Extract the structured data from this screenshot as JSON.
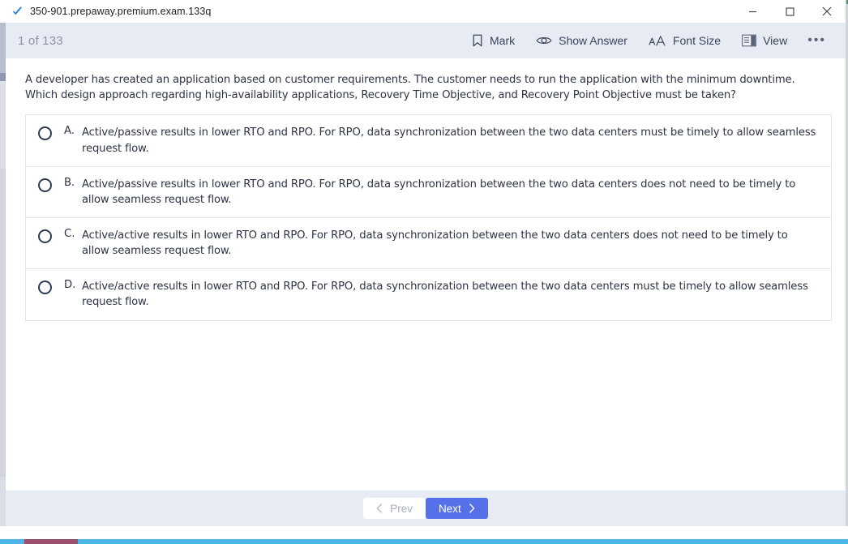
{
  "window": {
    "title": "350-901.prepaway.premium.exam.133q",
    "app_icon": "checkmark-icon",
    "controls": {
      "minimize": "minimize-icon",
      "maximize": "maximize-icon",
      "close": "close-icon"
    }
  },
  "toolbar": {
    "counter": "1 of 133",
    "actions": [
      {
        "label": "Mark",
        "icon": "bookmark-icon"
      },
      {
        "label": "Show Answer",
        "icon": "eye-icon"
      },
      {
        "label": "Font Size",
        "icon": "font-size-icon"
      },
      {
        "label": "View",
        "icon": "view-layout-icon"
      }
    ],
    "overflow": "•••"
  },
  "question": {
    "text": "A developer has created an application based on customer requirements. The customer needs to run the application with the minimum downtime. Which design approach regarding high-availability applications, Recovery Time Objective, and Recovery Point Objective must be taken?",
    "options": [
      {
        "letter": "A.",
        "text": "Active/passive results in lower RTO and RPO. For RPO, data synchronization between the two data centers must be timely to allow seamless request flow.",
        "selected": false
      },
      {
        "letter": "B.",
        "text": "Active/passive results in lower RTO and RPO. For RPO, data synchronization between the two data centers does not need to be timely to allow seamless request flow.",
        "selected": false
      },
      {
        "letter": "C.",
        "text": "Active/active results in lower RTO and RPO. For RPO, data synchronization between the two data centers does not need to be timely to allow seamless request flow.",
        "selected": false
      },
      {
        "letter": "D.",
        "text": "Active/active results in lower RTO and RPO. For RPO, data synchronization between the two data centers must be timely to allow seamless request flow.",
        "selected": false
      }
    ]
  },
  "footer": {
    "prev_label": "Prev",
    "next_label": "Next",
    "prev_icon": "chevron-left-icon",
    "next_icon": "chevron-right-icon"
  },
  "colors": {
    "toolbar_bg": "#e7ebf4",
    "next_button": "#5570e8",
    "text": "#2e3446",
    "counter_text": "#8c93a5"
  }
}
